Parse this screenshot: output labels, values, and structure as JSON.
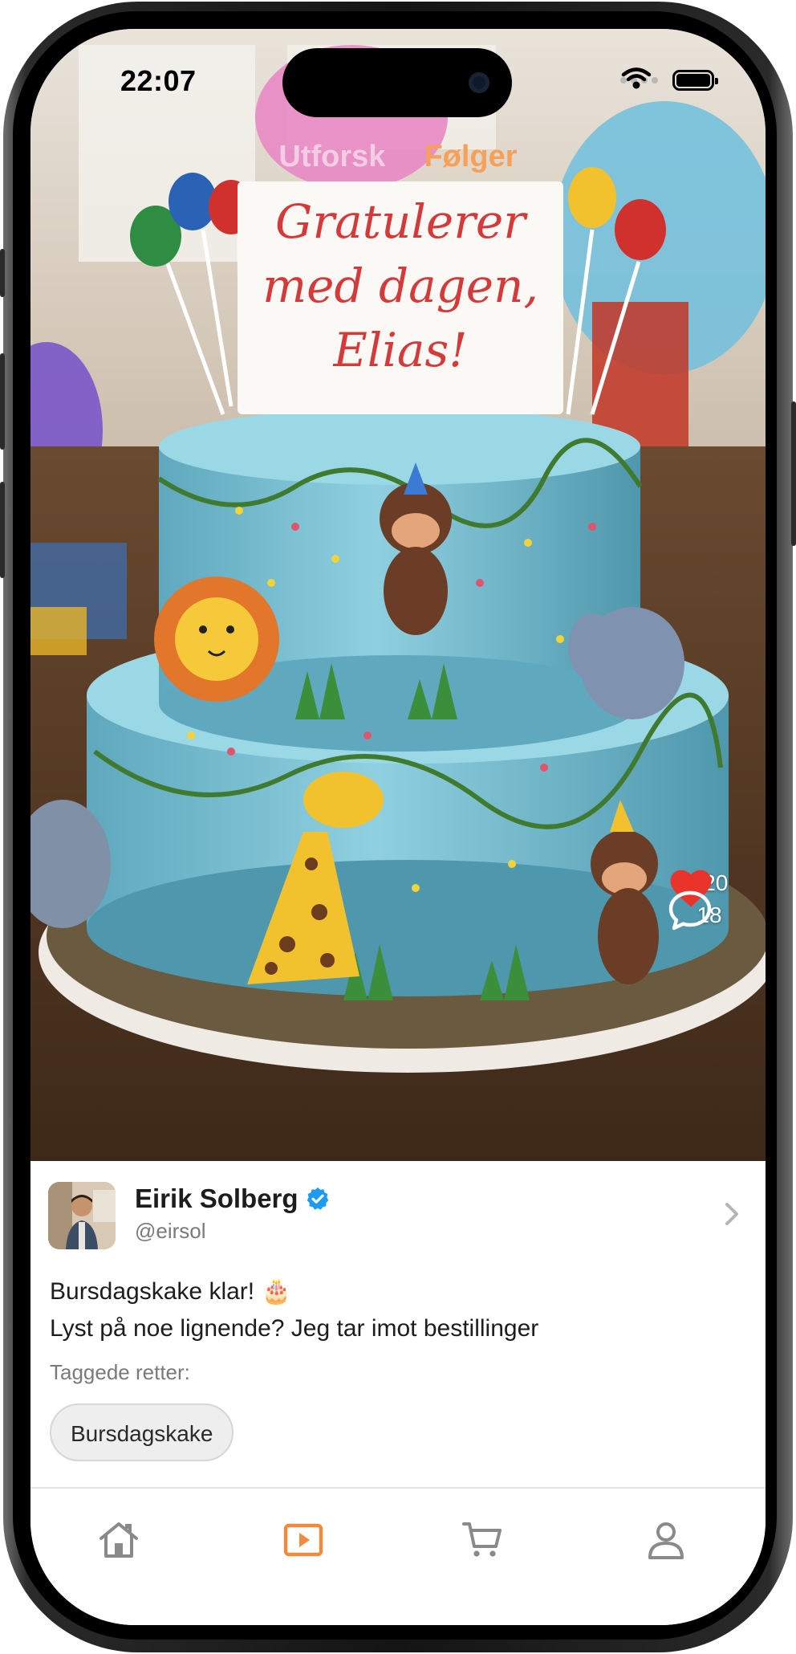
{
  "status_bar": {
    "time": "22:07"
  },
  "top_tabs": [
    {
      "label": "Utforsk",
      "active": false
    },
    {
      "label": "Følger",
      "active": true
    }
  ],
  "media": {
    "cake_topper_lines": [
      "Gratulerer",
      "med dagen,",
      "Elias!"
    ]
  },
  "actions": {
    "likes": "120",
    "comments": "18",
    "like_color": "#e8342a"
  },
  "post": {
    "author_name": "Eirik Solberg",
    "author_handle": "@eirsol",
    "verified": true,
    "caption_line1": "Bursdagskake klar! 🎂",
    "caption_line2": "Lyst på noe lignende? Jeg tar imot bestillinger",
    "tagged_label": "Taggede retter:",
    "tags": [
      "Bursdagskake"
    ]
  },
  "tabbar": {
    "items": [
      {
        "icon": "home-icon",
        "active": false
      },
      {
        "icon": "play-icon",
        "active": true
      },
      {
        "icon": "cart-icon",
        "active": false
      },
      {
        "icon": "profile-icon",
        "active": false
      }
    ],
    "active_color": "#f08a3c",
    "inactive_color": "#8a8a8a"
  },
  "colors": {
    "accent": "#f5a15a",
    "verified": "#1d9bf0"
  }
}
